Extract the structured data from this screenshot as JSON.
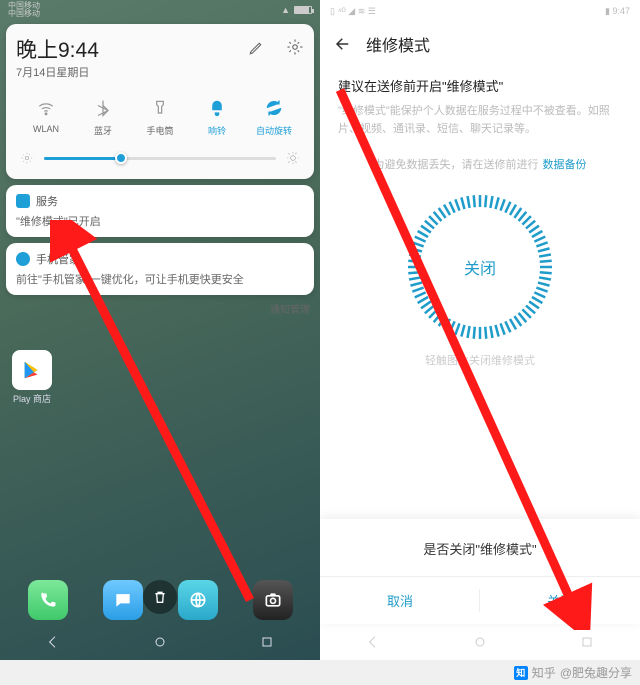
{
  "left": {
    "status": {
      "carrier_line1": "中国移动",
      "carrier_line2": "中国移动"
    },
    "panel": {
      "time": "晚上9:44",
      "date": "7月14日星期日",
      "toggles": [
        {
          "label": "WLAN",
          "active": false
        },
        {
          "label": "蓝牙",
          "active": false
        },
        {
          "label": "手电筒",
          "active": false
        },
        {
          "label": "响铃",
          "active": true
        },
        {
          "label": "自动旋转",
          "active": true
        }
      ]
    },
    "notifications": [
      {
        "app": "服务",
        "body": "\"维修模式\"已开启",
        "icon_color": "#1e9fd8"
      },
      {
        "app": "手机管家",
        "body": "前往\"手机管家\"一键优化，可让手机更快更安全",
        "icon_color": "#1e9fd8"
      }
    ],
    "notif_manage": "通知管理",
    "home_app": "Play 商店"
  },
  "right": {
    "status_time": "9:47",
    "header_title": "维修模式",
    "heading": "建议在送修前开启\"维修模式\"",
    "description": "\"维修模式\"能保护个人数据在服务过程中不被查看。如照片、视频、通讯录、短信、聊天记录等。",
    "banner_prefix": "为避免数据丢失，请在送修前进行",
    "banner_link": "数据备份",
    "circle_label": "关闭",
    "circle_hint": "轻触图片关闭维修模式",
    "dialog": {
      "title": "是否关闭\"维修模式\"",
      "cancel": "取消",
      "confirm": "关闭"
    }
  },
  "watermark": {
    "prefix": "知乎",
    "author": "@肥兔趣分享"
  }
}
